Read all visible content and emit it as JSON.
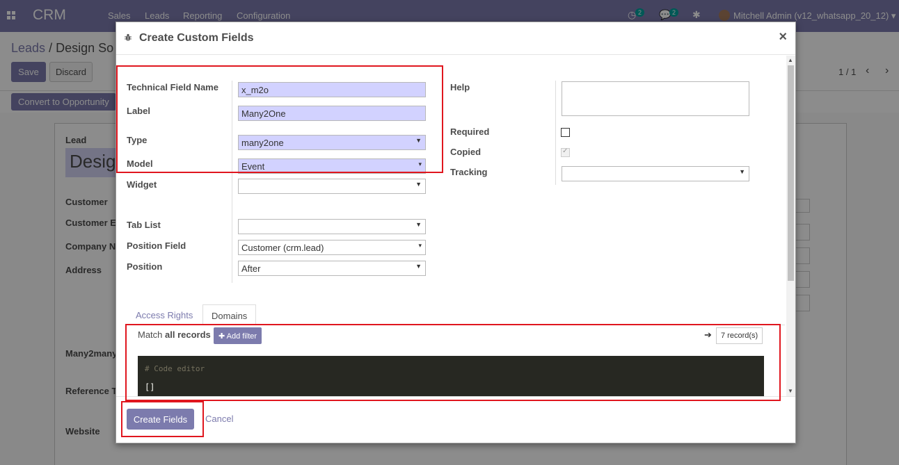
{
  "topbar": {
    "brand": "CRM",
    "menu": [
      "Sales",
      "Leads",
      "Reporting",
      "Configuration"
    ],
    "activity_count": "2",
    "messages_count": "2",
    "user": "Mitchell Admin (v12_whatsapp_20_12)"
  },
  "control": {
    "breadcrumb_parent": "Leads",
    "breadcrumb_current": "Design So",
    "save_label": "Save",
    "discard_label": "Discard",
    "pager": "1 / 1"
  },
  "statusbar": {
    "convert_label": "Convert to Opportunity"
  },
  "background_form": {
    "lead_label": "Lead",
    "lead_title": "Desig",
    "labels": [
      "Customer",
      "Customer E",
      "Company N",
      "Address",
      "Many2many",
      "Reference T",
      "Website"
    ]
  },
  "dialog": {
    "title": "Create Custom Fields",
    "close": "×",
    "fields": {
      "technical_name": {
        "label": "Technical Field Name",
        "value": "x_m2o"
      },
      "label": {
        "label": "Label",
        "value": "Many2One"
      },
      "type": {
        "label": "Type",
        "value": "many2one"
      },
      "model": {
        "label": "Model",
        "value": "Event"
      },
      "widget": {
        "label": "Widget",
        "value": ""
      },
      "tab_list": {
        "label": "Tab List",
        "value": ""
      },
      "position_field": {
        "label": "Position Field",
        "value": "Customer (crm.lead)"
      },
      "position": {
        "label": "Position",
        "value": "After"
      },
      "help": {
        "label": "Help",
        "value": ""
      },
      "required": {
        "label": "Required",
        "checked": false
      },
      "copied": {
        "label": "Copied",
        "checked": true
      },
      "tracking": {
        "label": "Tracking",
        "value": ""
      }
    },
    "tabs": [
      {
        "label": "Access Rights",
        "active": false
      },
      {
        "label": "Domains",
        "active": true
      }
    ],
    "domain": {
      "match_prefix": "Match",
      "match_bold": "all records",
      "add_filter": "Add filter",
      "records": "7 record(s)",
      "code_comment": "# Code editor",
      "code_value": "[]"
    },
    "footer": {
      "create_label": "Create Fields",
      "cancel_label": "Cancel"
    }
  },
  "colors": {
    "primary": "#7c7bad",
    "required_field": "#d2d2ff",
    "highlight_box": "#e0161e",
    "code_bg": "#272822"
  }
}
